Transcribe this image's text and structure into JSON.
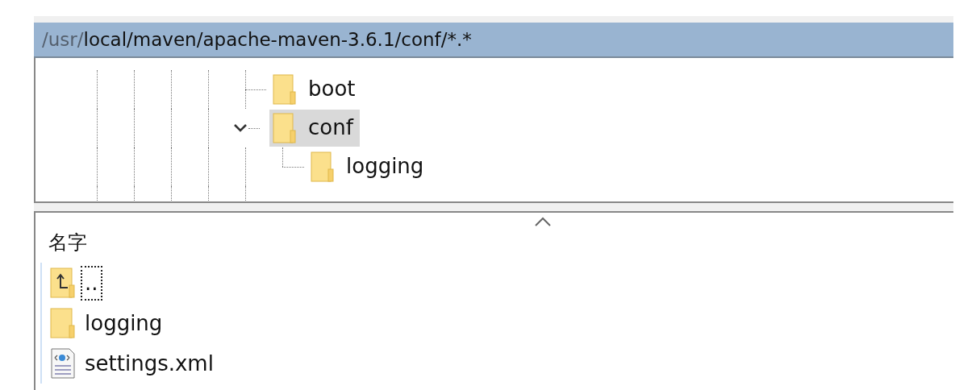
{
  "path_bar": {
    "dim_part": "/usr/",
    "main_part": "local/maven/apache-maven-3.6.1/conf/*.*"
  },
  "tree": [
    {
      "label": "boot",
      "selected": false,
      "expanded": false
    },
    {
      "label": "conf",
      "selected": true,
      "expanded": true,
      "children": [
        {
          "label": "logging",
          "selected": false,
          "expanded": false
        }
      ]
    }
  ],
  "file_list": {
    "column": "名字",
    "sort_ascending": true,
    "rows": [
      {
        "kind": "parent",
        "name": "..",
        "focused": true
      },
      {
        "kind": "folder",
        "name": "logging",
        "focused": false
      },
      {
        "kind": "file",
        "name": "settings.xml",
        "focused": false
      }
    ]
  }
}
